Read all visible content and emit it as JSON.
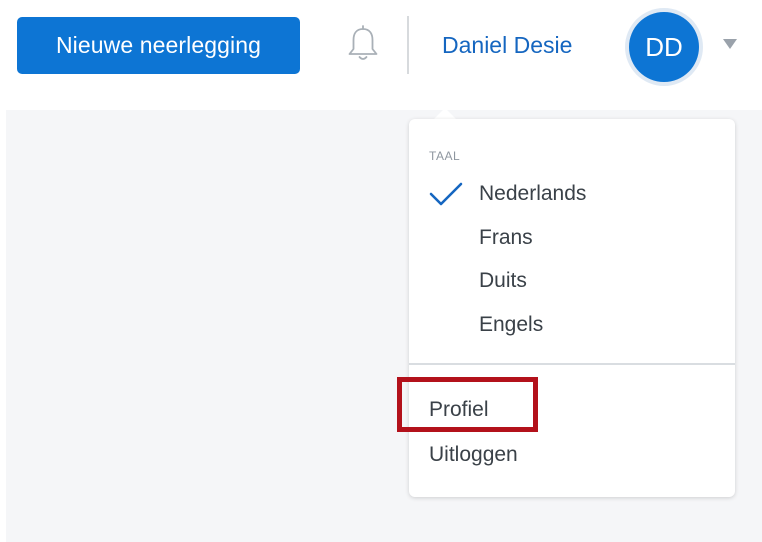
{
  "header": {
    "new_filing_label": "Nieuwe neerlegging",
    "user_name": "Daniel Desie",
    "avatar_initials": "DD",
    "icons": {
      "notifications": "bell-icon",
      "user_menu": "caret-down-icon"
    }
  },
  "user_menu": {
    "language_section_label": "TAAL",
    "languages": [
      {
        "label": "Nederlands",
        "selected": true
      },
      {
        "label": "Frans",
        "selected": false
      },
      {
        "label": "Duits",
        "selected": false
      },
      {
        "label": "Engels",
        "selected": false
      }
    ],
    "profile_label": "Profiel",
    "logout_label": "Uitloggen"
  },
  "colors": {
    "primary": "#0d75d4",
    "link": "#1566c0",
    "highlight": "#b3111b",
    "content_bg": "#f5f6f8"
  }
}
